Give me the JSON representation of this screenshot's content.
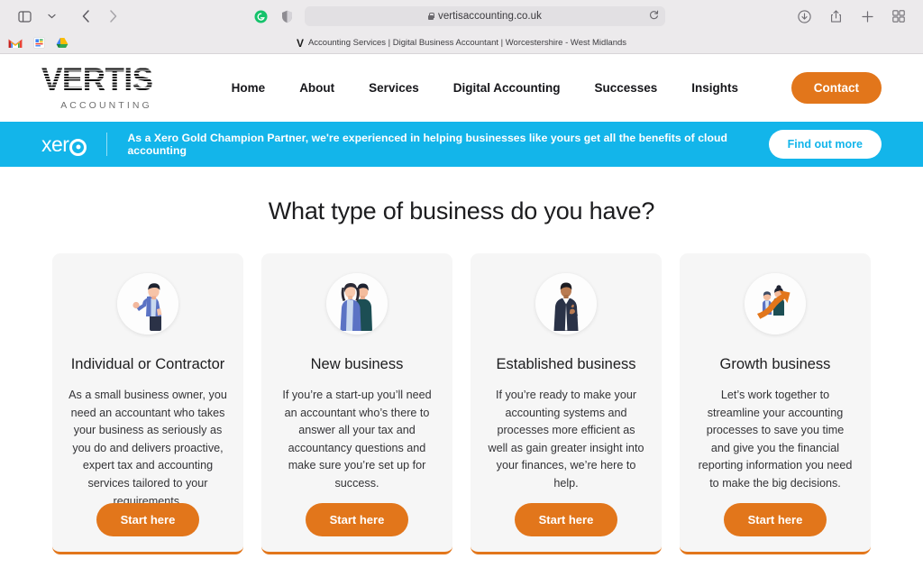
{
  "browser": {
    "url": "vertisaccounting.co.uk",
    "tab_title": "Accounting Services | Digital Business Accountant | Worcestershire - West Midlands",
    "tab_favicon": "V",
    "sidebar_icon": "sidebar-icon",
    "back_icon": "back-arrow-icon",
    "forward_icon": "forward-arrow-icon",
    "reload_icon": "reload-icon",
    "lock_icon": "lock-icon",
    "download_icon": "download-icon",
    "share_icon": "share-icon",
    "newtab_icon": "plus-icon",
    "tabs_icon": "tab-overview-icon",
    "bookmarks": [
      {
        "name": "gmail",
        "label": "M"
      },
      {
        "name": "google-docs",
        "label": ""
      },
      {
        "name": "google-drive",
        "label": ""
      }
    ]
  },
  "site": {
    "logo": {
      "word": "VERTIS",
      "sub": "ACCOUNTING"
    },
    "nav": [
      {
        "label": "Home"
      },
      {
        "label": "About"
      },
      {
        "label": "Services"
      },
      {
        "label": "Digital Accounting"
      },
      {
        "label": "Successes"
      },
      {
        "label": "Insights"
      }
    ],
    "cta": "Contact"
  },
  "banner": {
    "logo_text": "xer",
    "message": "As a Xero Gold Champion Partner, we're experienced in helping businesses like yours get all the benefits of cloud accounting",
    "button": "Find out more",
    "bg_color": "#13B5EA"
  },
  "main": {
    "heading": "What type of business do you have?",
    "cards": [
      {
        "title": "Individual or Contractor",
        "body": "As a small business owner, you need an accountant who takes your business as seriously as you do and delivers proactive, expert tax and accounting services tailored to your requirements.",
        "button": "Start here",
        "illustration": "man-waving-illustration"
      },
      {
        "title": "New business",
        "body": "If you’re a start-up you’ll need an accountant who’s there to answer all your tax and accountancy questions and make sure you’re set up for success.",
        "button": "Start here",
        "illustration": "couple-illustration"
      },
      {
        "title": "Established business",
        "body": "If you’re ready to make your accounting systems and processes more efficient as well as gain greater insight into your finances, we’re here to help.",
        "button": "Start here",
        "illustration": "businessman-thumbsup-illustration"
      },
      {
        "title": "Growth business",
        "body": "Let’s work together to streamline your accounting processes to save you time and give you the financial reporting information you need to make the big decisions.",
        "button": "Start here",
        "illustration": "growth-arrow-illustration"
      }
    ]
  },
  "colors": {
    "accent_orange": "#E2761B",
    "xero_blue": "#13B5EA",
    "card_bg": "#F6F6F6"
  }
}
